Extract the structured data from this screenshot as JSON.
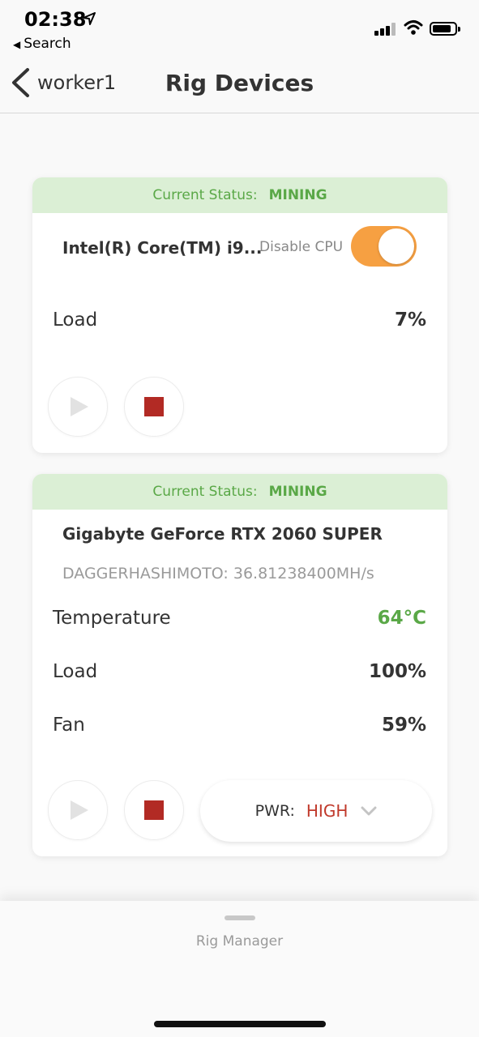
{
  "status_bar": {
    "time": "02:38",
    "back_app": "Search"
  },
  "nav": {
    "back_label": "worker1",
    "title": "Rig Devices"
  },
  "devices": [
    {
      "status_label": "Current Status:",
      "status_value": "MINING",
      "name": "Intel(R) Core(TM) i9...",
      "toggle_label": "Disable CPU",
      "toggle_on": true,
      "metrics": [
        {
          "label": "Load",
          "value": "7%"
        }
      ]
    },
    {
      "status_label": "Current Status:",
      "status_value": "MINING",
      "name": "Gigabyte GeForce RTX 2060 SUPER",
      "algorithm": "DAGGERHASHIMOTO: 36.81238400MH/s",
      "metrics": [
        {
          "label": "Temperature",
          "value": "64°C"
        },
        {
          "label": "Load",
          "value": "100%"
        },
        {
          "label": "Fan",
          "value": "59%"
        }
      ],
      "power_label": "PWR:",
      "power_value": "HIGH"
    }
  ],
  "bottom_sheet": {
    "title": "Rig Manager"
  },
  "colors": {
    "status_bg": "#dbefd5",
    "status_text": "#5aa847",
    "toggle_on": "#f6a042",
    "stop": "#b22a24",
    "power_high": "#c0392b"
  },
  "icons": [
    "location-arrow-icon",
    "back-triangle-icon",
    "signal-icon",
    "wifi-icon",
    "battery-icon",
    "chevron-left-icon",
    "play-icon",
    "stop-icon",
    "chevron-down-icon"
  ]
}
